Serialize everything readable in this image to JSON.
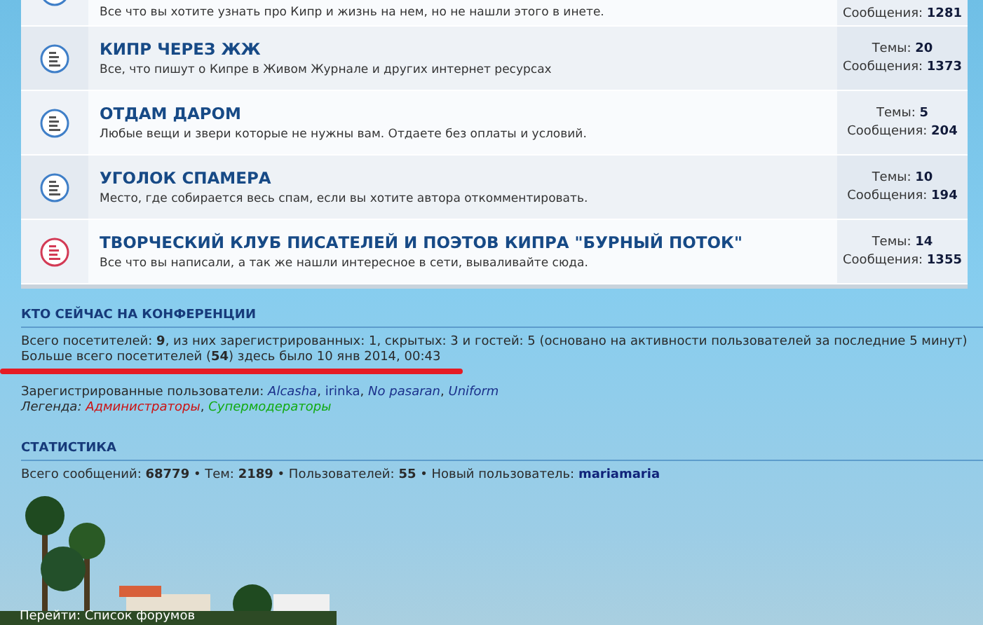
{
  "forums": [
    {
      "description": "Все что вы хотите узнать про Кипр и жизнь на нем, но не нашли этого в инете.",
      "posts": "Сообщения: **1281**",
      "unread": false
    },
    {
      "title": "КИПР ЧЕРЕЗ ЖЖ",
      "description": "Все, что пишут о Кипре в Живом Журнале и других интернет ресурсах",
      "topics": "Темы: **20**",
      "posts": "Сообщения: **1373**",
      "unread": false
    },
    {
      "title": "ОТДАМ ДАРОМ",
      "description": "Любые вещи и звери которые не нужны вам. Отдаете без оплаты и условий.",
      "topics": "Темы: **5**",
      "posts": "Сообщения: **204**",
      "unread": false
    },
    {
      "title": "УГОЛОК СПАМЕРА",
      "description": "Место, где собирается весь спам, если вы хотите автора откомментировать.",
      "topics": "Темы: **10**",
      "posts": "Сообщения: **194**",
      "unread": false
    },
    {
      "title": "ТВОРЧЕСКИЙ КЛУБ ПИСАТЕЛЕЙ И ПОЭТОВ КИПРА \"БУРНЫЙ ПОТОК\"",
      "description": "Все что вы написали, а так же нашли интересное в сети, вываливайте сюда.",
      "topics": "Темы: **14**",
      "posts": "Сообщения: **1355**",
      "unread": true
    }
  ],
  "online": {
    "heading": "КТО СЕЙЧАС НА КОНФЕРЕНЦИИ",
    "summary": "Всего посетителей: **9**, из них зарегистрированных: 1, скрытых: 3 и гостей: 5 (основано на активности пользователей за последние 5 минут)",
    "record": "Больше всего посетителей (**54**) здесь было 10 янв 2014, 00:43",
    "users_label": "Зарегистрированные пользователи:",
    "separator": ",",
    "users": [
      {
        "name": "Alcasha",
        "italic": true
      },
      {
        "name": "irinka",
        "italic": false
      },
      {
        "name": "No pasaran",
        "italic": true
      },
      {
        "name": "Uniform",
        "italic": true
      }
    ],
    "legend_label": "Легенда:",
    "legend": [
      {
        "name": "Администраторы",
        "color": "#cc1111"
      },
      {
        "name": "Супермодераторы",
        "color": "#11aa11"
      }
    ]
  },
  "statistics": {
    "heading": "СТАТИСТИКА",
    "text": "Всего сообщений: **68779** • Тем: **2189** • Пользователей: **55** • Новый пользователь: ",
    "newest_user": "mariamaria"
  },
  "footer": {
    "jump": "Перейти: Список форумов"
  }
}
